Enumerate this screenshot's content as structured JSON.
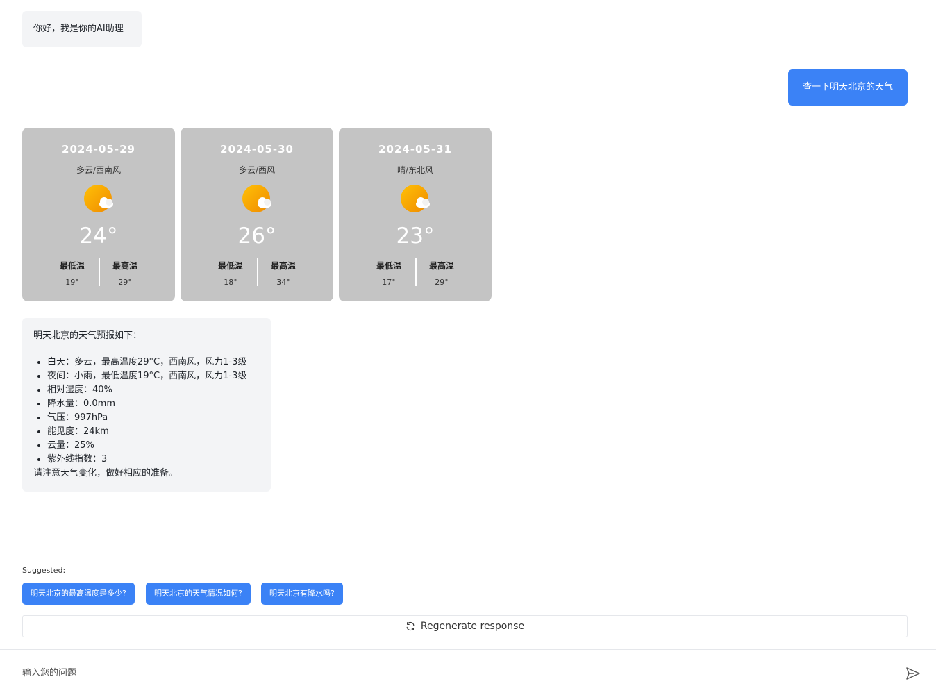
{
  "greeting": "你好，我是你的AI助理",
  "user_message": "查一下明天北京的天气",
  "weather_cards": [
    {
      "date": "2024-05-29",
      "condition": "多云/西南风",
      "temp": "24°",
      "low_label": "最低温",
      "low": "19°",
      "high_label": "最高温",
      "high": "29°",
      "icon": "partly-cloudy-icon"
    },
    {
      "date": "2024-05-30",
      "condition": "多云/西风",
      "temp": "26°",
      "low_label": "最低温",
      "low": "18°",
      "high_label": "最高温",
      "high": "34°",
      "icon": "partly-cloudy-icon"
    },
    {
      "date": "2024-05-31",
      "condition": "晴/东北风",
      "temp": "23°",
      "low_label": "最低温",
      "low": "17°",
      "high_label": "最高温",
      "high": "29°",
      "icon": "partly-cloudy-icon"
    }
  ],
  "forecast": {
    "intro": "明天北京的天气预报如下：",
    "items": [
      "白天：多云，最高温度29°C，西南风，风力1-3级",
      "夜间：小雨，最低温度19°C，西南风，风力1-3级",
      "相对湿度：40%",
      "降水量：0.0mm",
      "气压：997hPa",
      "能见度：24km",
      "云量：25%",
      "紫外线指数：3"
    ],
    "outro": "请注意天气变化，做好相应的准备。"
  },
  "suggested": {
    "title": "Suggested:",
    "chips": [
      "明天北京的最高温度是多少?",
      "明天北京的天气情况如何?",
      "明天北京有降水吗?"
    ]
  },
  "regenerate_label": "Regenerate response",
  "input": {
    "placeholder": "输入您的问题",
    "value": ""
  },
  "colors": {
    "accent": "#3b82f6",
    "card_bg": "#c4c4c4",
    "bubble_bg": "#f3f4f6"
  }
}
